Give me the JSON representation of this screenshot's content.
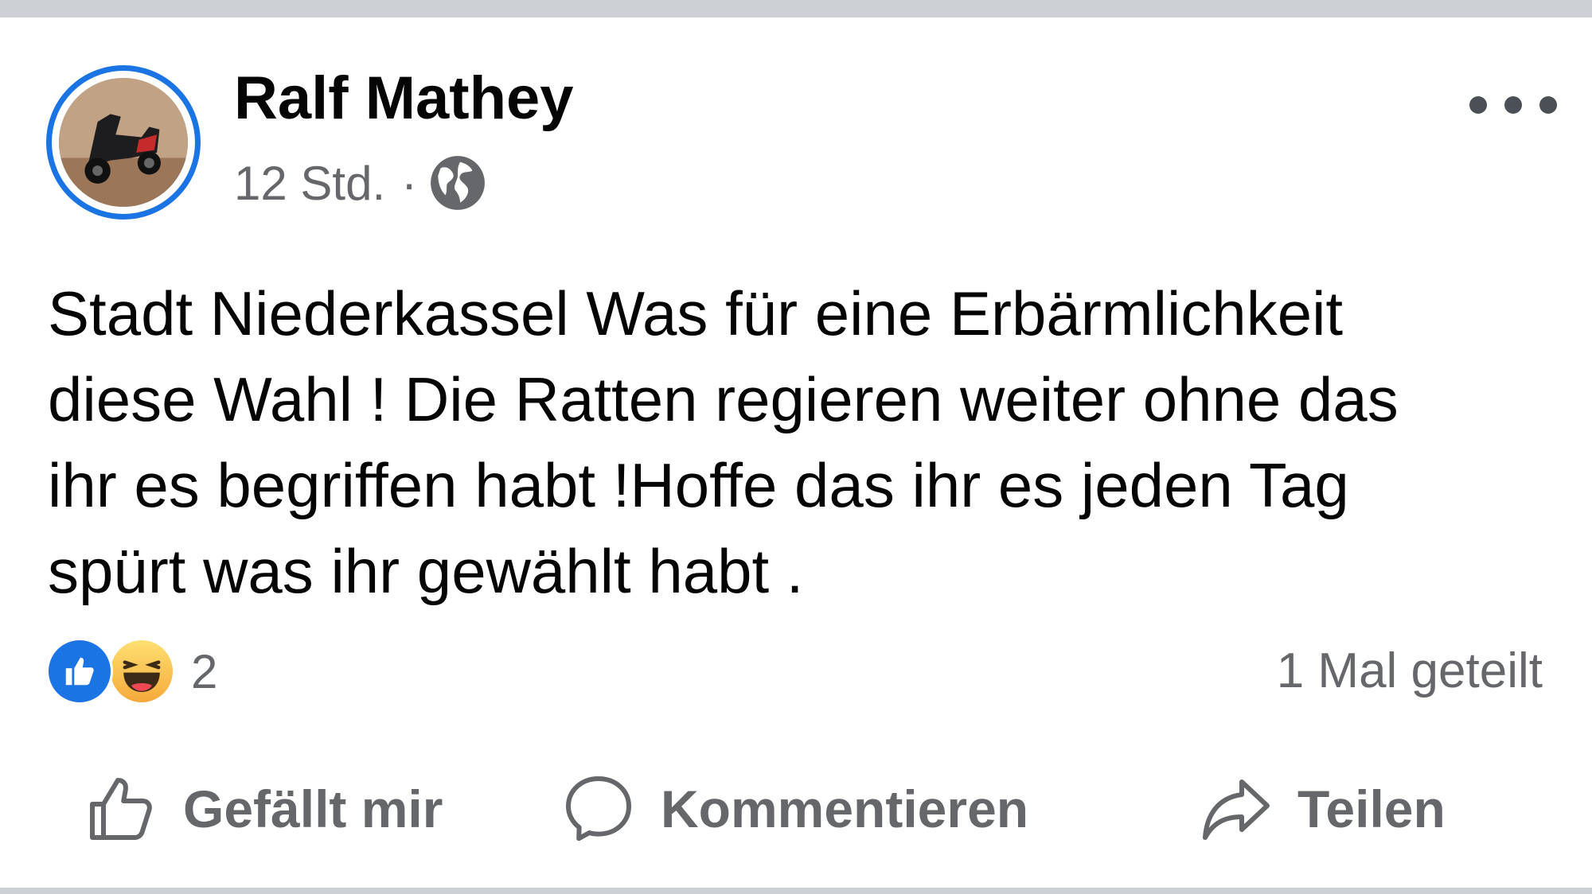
{
  "post": {
    "author": "Ralf Mathey",
    "time": "12 Std.",
    "separator": "·",
    "privacy_icon": "globe-icon",
    "text": "Stadt Niederkassel Was für eine Erbärmlichkeit\ndiese Wahl ! Die Ratten regieren weiter ohne das\nihr es begriffen habt !Hoffe das ihr es jeden Tag\nspürt was ihr gewählt habt .",
    "reactions": {
      "types": [
        "like",
        "haha"
      ],
      "count": "2"
    },
    "shares": "1 Mal geteilt",
    "actions": {
      "like": "Gefällt mir",
      "comment": "Kommentieren",
      "share": "Teilen"
    }
  },
  "colors": {
    "accent_blue": "#1b74e4",
    "secondary_text": "#65676b",
    "primary_text": "#050505",
    "divider": "#cdd0d4"
  }
}
